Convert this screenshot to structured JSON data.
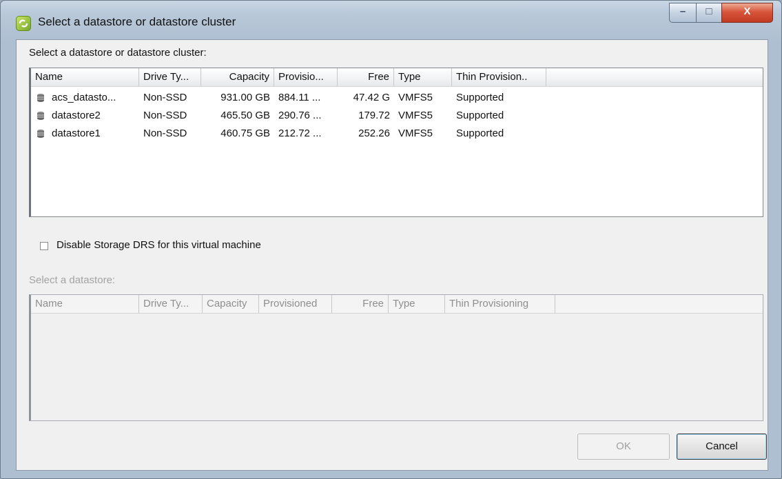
{
  "window": {
    "title": "Select a datastore or datastore cluster",
    "controls": {
      "minimize": "–",
      "maximize": "□",
      "close": "X"
    }
  },
  "cluster_section": {
    "label": "Select a datastore or datastore cluster:",
    "columns": [
      "Name",
      "Drive Ty...",
      "Capacity",
      "Provisio...",
      "Free",
      "Type",
      "Thin Provision.."
    ],
    "rows": [
      {
        "name": "acs_datasto...",
        "drive_type": "Non-SSD",
        "capacity": "931.00 GB",
        "provisioned": "884.11 ...",
        "free": "47.42 G",
        "type": "VMFS5",
        "thin": "Supported"
      },
      {
        "name": "datastore2",
        "drive_type": "Non-SSD",
        "capacity": "465.50 GB",
        "provisioned": "290.76 ...",
        "free": "179.72",
        "type": "VMFS5",
        "thin": "Supported"
      },
      {
        "name": "datastore1",
        "drive_type": "Non-SSD",
        "capacity": "460.75 GB",
        "provisioned": "212.72 ...",
        "free": "252.26",
        "type": "VMFS5",
        "thin": "Supported"
      }
    ]
  },
  "disable_drs": {
    "label": "Disable Storage DRS for this virtual machine",
    "checked": false
  },
  "datastore_section": {
    "label": "Select a datastore:",
    "columns": [
      "Name",
      "Drive Ty...",
      "Capacity",
      "Provisioned",
      "Free",
      "Type",
      "Thin Provisioning"
    ]
  },
  "buttons": {
    "ok": "OK",
    "cancel": "Cancel"
  }
}
